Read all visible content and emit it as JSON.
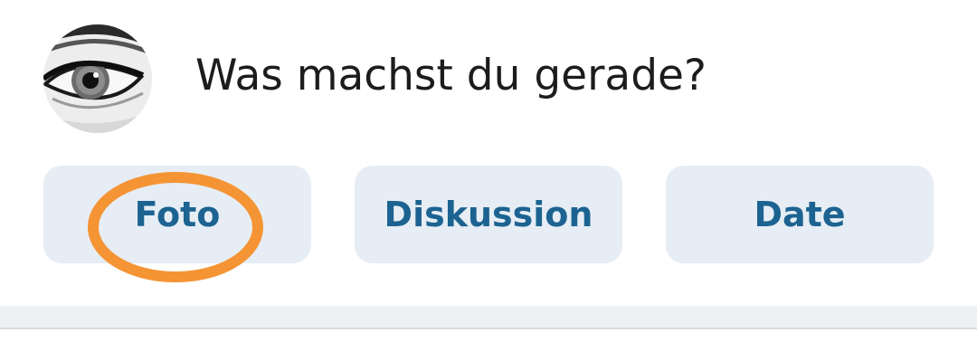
{
  "composer": {
    "prompt": "Was machst du gerade?",
    "avatar_icon": "eye-photo-avatar"
  },
  "actions": {
    "foto_label": "Foto",
    "diskussion_label": "Diskussion",
    "date_label": "Date"
  },
  "colors": {
    "button_bg": "#e6edf4",
    "button_text": "#1c6391",
    "highlight": "#f59434"
  }
}
